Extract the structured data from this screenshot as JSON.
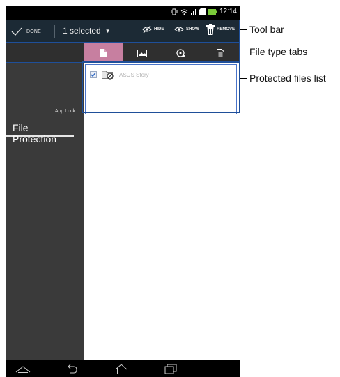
{
  "status_bar": {
    "time": "12:14"
  },
  "toolbar": {
    "done_label": "DONE",
    "selection_label": "1 selected",
    "hide_label": "HIDE",
    "show_label": "SHOW",
    "remove_label": "REMOVE"
  },
  "tabs": [
    {
      "icon": "document-file-icon",
      "active": true
    },
    {
      "icon": "image-icon",
      "active": false
    },
    {
      "icon": "audio-file-icon",
      "active": false
    },
    {
      "icon": "text-file-icon",
      "active": false
    }
  ],
  "sidebar": {
    "section_label": "App Lock",
    "item_label": "File Protection"
  },
  "file_list": {
    "items": [
      {
        "name": "ASUS Story",
        "checked": true,
        "icon": "protected-folder-icon"
      }
    ]
  },
  "nav_bar": {
    "icons": [
      "up-chevron-icon",
      "back-icon",
      "home-icon",
      "recent-apps-icon"
    ]
  },
  "callouts": {
    "tool_bar": "Tool bar",
    "file_type_tabs": "File type tabs",
    "protected_files_list": "Protected files list"
  },
  "colors": {
    "toolbar_bg": "#1c2a35",
    "active_tab": "#c77fa0",
    "sidebar_bg": "#3a3a3a",
    "highlight_outline": "#1f4f99"
  }
}
